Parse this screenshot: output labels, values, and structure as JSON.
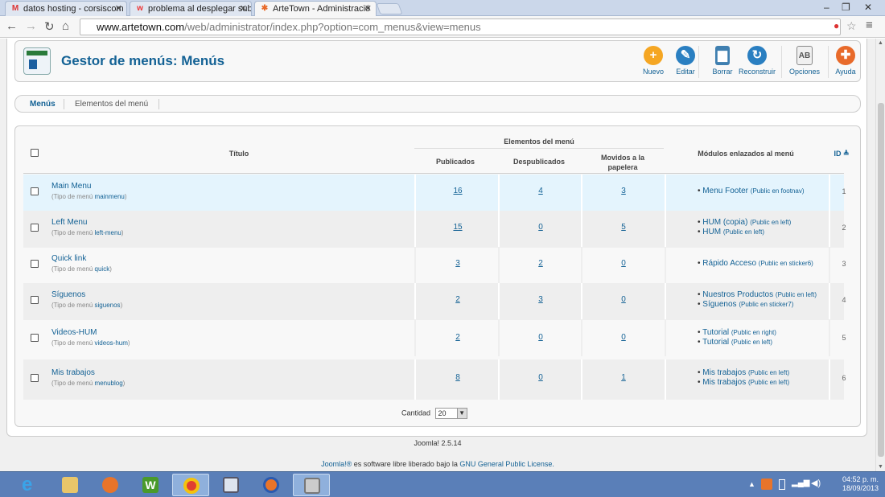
{
  "browser": {
    "tabs": [
      {
        "icon": "gmail-icon",
        "label": "datos hosting - corsiscom"
      },
      {
        "icon": "webnode-icon",
        "label": "problema al desplegar sub"
      },
      {
        "icon": "joomla-icon",
        "label": "ArteTown - Administració"
      }
    ],
    "url_host": "www.artetown.com",
    "url_path": "/web/administrator/index.php?option=com_menus&view=menus"
  },
  "toolbar": {
    "title": "Gestor de menús: Menús",
    "buttons": [
      {
        "label": "Nuevo",
        "icon": "new-icon",
        "color": "#f5a623"
      },
      {
        "label": "Editar",
        "icon": "edit-icon",
        "color": "#2a7fc1"
      },
      {
        "label": "Borrar",
        "icon": "trash-icon",
        "color": "#3f7fb0"
      },
      {
        "label": "Reconstruir",
        "icon": "rebuild-icon",
        "color": "#2a7fc1"
      },
      {
        "label": "Opciones",
        "icon": "options-icon",
        "color": "#888888"
      },
      {
        "label": "Ayuda",
        "icon": "help-icon",
        "color": "#e86a2a"
      }
    ]
  },
  "subnav": {
    "items": [
      "Menús",
      "Elementos del menú"
    ]
  },
  "table": {
    "headers": {
      "title": "Título",
      "group": "Elementos del menú",
      "published": "Publicados",
      "unpublished": "Despublicados",
      "trashed": "Movidos a la papelera",
      "modules": "Módulos enlazados al menú",
      "id": "ID"
    },
    "type_label": "(Tipo de menú",
    "rows": [
      {
        "title": "Main Menu",
        "type": "mainmenu",
        "published": "16",
        "unpublished": "4",
        "trashed": "3",
        "modules": [
          {
            "name": "Menu Footer",
            "pos": "(Public en footnav)"
          }
        ],
        "id": "1"
      },
      {
        "title": "Left Menu",
        "type": "left-menu",
        "published": "15",
        "unpublished": "0",
        "trashed": "5",
        "modules": [
          {
            "name": "HUM (copia)",
            "pos": "(Public en left)"
          },
          {
            "name": "HUM",
            "pos": "(Public en left)"
          }
        ],
        "id": "2"
      },
      {
        "title": "Quick link",
        "type": "quick",
        "published": "3",
        "unpublished": "2",
        "trashed": "0",
        "modules": [
          {
            "name": "Rápido Acceso",
            "pos": "(Public en sticker6)"
          }
        ],
        "id": "3"
      },
      {
        "title": "Síguenos",
        "type": "siguenos",
        "published": "2",
        "unpublished": "3",
        "trashed": "0",
        "modules": [
          {
            "name": "Nuestros Productos",
            "pos": "(Public en left)"
          },
          {
            "name": "Síguenos",
            "pos": "(Public en sticker7)"
          }
        ],
        "id": "4"
      },
      {
        "title": "Videos-HUM",
        "type": "videos-hum",
        "published": "2",
        "unpublished": "0",
        "trashed": "0",
        "modules": [
          {
            "name": "Tutorial",
            "pos": "(Public en right)"
          },
          {
            "name": "Tutorial",
            "pos": "(Public en left)"
          }
        ],
        "id": "5"
      },
      {
        "title": "Mis trabajos",
        "type": "menublog",
        "published": "8",
        "unpublished": "0",
        "trashed": "1",
        "modules": [
          {
            "name": "Mis trabajos",
            "pos": "(Public en left)"
          },
          {
            "name": "Mis trabajos",
            "pos": "(Public en left)"
          }
        ],
        "id": "6"
      }
    ]
  },
  "pagination": {
    "label": "Cantidad",
    "value": "20"
  },
  "footer": {
    "version": "Joomla! 2.5.14",
    "license_prefix": "Joomla!®",
    "license_middle": " es software libre liberado bajo la ",
    "license_link": "GNU General Public License."
  },
  "taskbar": {
    "time": "04:52 p. m.",
    "date": "18/09/2013"
  }
}
